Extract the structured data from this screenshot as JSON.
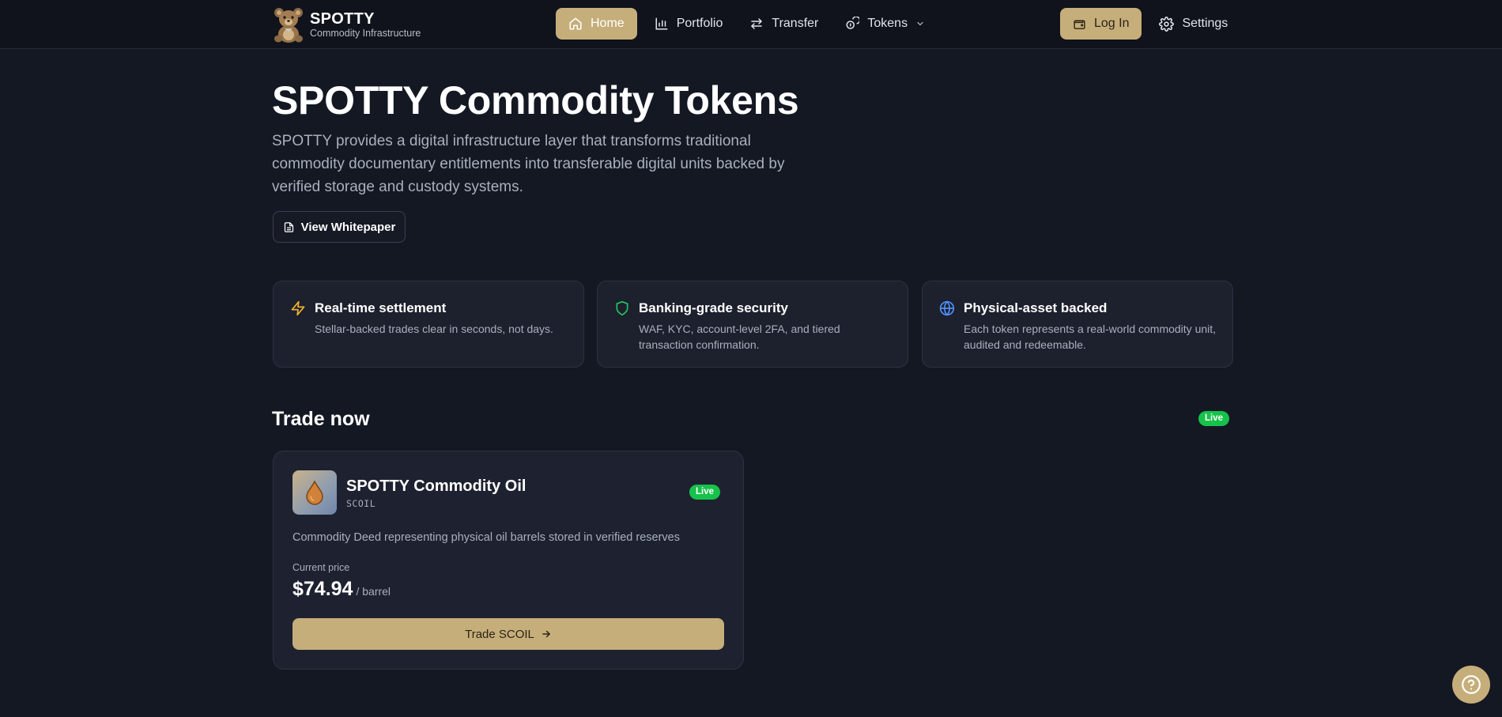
{
  "brand": {
    "name": "SPOTTY",
    "subtitle": "Commodity Infrastructure"
  },
  "nav": {
    "home": "Home",
    "portfolio": "Portfolio",
    "transfer": "Transfer",
    "tokens": "Tokens",
    "login": "Log In",
    "settings": "Settings"
  },
  "hero": {
    "title": "SPOTTY Commodity Tokens",
    "description": "SPOTTY provides a digital infrastructure layer that transforms traditional commodity documentary entitlements into transferable digital units backed by verified storage and custody systems.",
    "whitepaper_label": "View Whitepaper"
  },
  "features": [
    {
      "title": "Real-time settlement",
      "description": "Stellar-backed trades clear in seconds, not days.",
      "icon": "lightning-icon"
    },
    {
      "title": "Banking-grade security",
      "description": "WAF, KYC, account-level 2FA, and tiered transaction confirmation.",
      "icon": "shield-icon"
    },
    {
      "title": "Physical-asset backed",
      "description": "Each token represents a real-world commodity unit, audited and redeemable.",
      "icon": "globe-icon"
    }
  ],
  "trade": {
    "section_title": "Trade now",
    "live_label": "Live",
    "token": {
      "name": "SPOTTY Commodity Oil",
      "symbol": "SCOIL",
      "status": "Live",
      "description": "Commodity Deed representing physical oil barrels stored in verified reserves",
      "price_label": "Current price",
      "price": "$74.94",
      "unit": "/ barrel",
      "button_label": "Trade SCOIL"
    }
  },
  "colors": {
    "accent": "#c6ae7b",
    "background": "#141823",
    "live": "#17c24a",
    "card": "#1e2230"
  }
}
